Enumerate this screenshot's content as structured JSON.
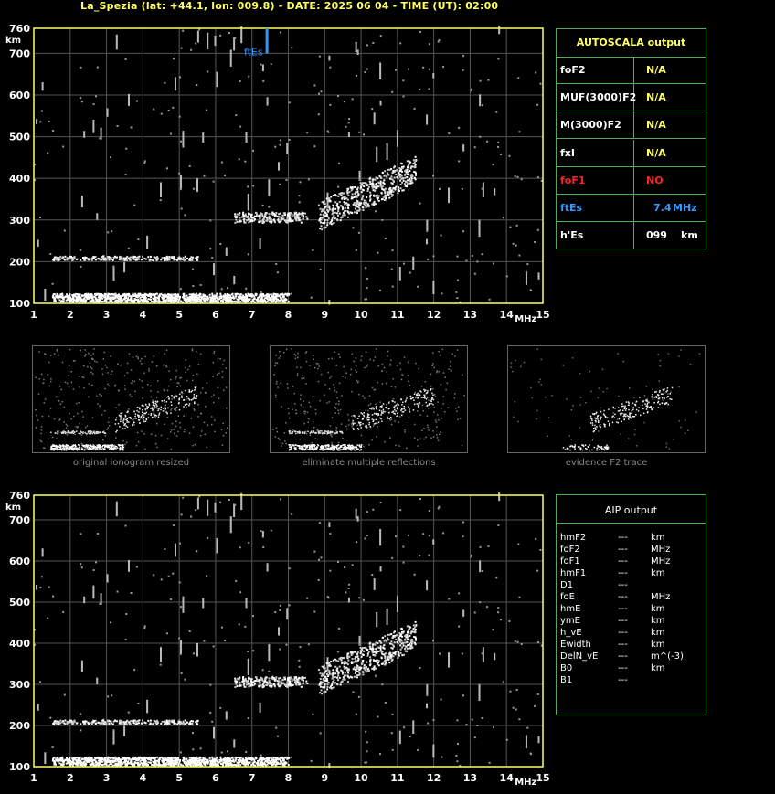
{
  "header": {
    "title": "La_Spezia (lat: +44.1, lon: 009.8) - DATE: 2025 06 04 - TIME (UT): 02:00"
  },
  "colors": {
    "background": "#000000",
    "axis": "#ffff66",
    "grid": "#555555",
    "panel_border": "#4caf50",
    "na_text": "#ffff66",
    "no_text": "#ff2222",
    "fte_text": "#3399ff",
    "trace": "#ffffff"
  },
  "chart_data": [
    {
      "type": "scatter",
      "name": "main-ionogram",
      "xlabel": "MHz",
      "ylabel": "km",
      "xlim": [
        1,
        15
      ],
      "ylim": [
        100,
        760
      ],
      "xticks": [
        1,
        2,
        3,
        4,
        5,
        6,
        7,
        8,
        9,
        10,
        11,
        12,
        13,
        14,
        15
      ],
      "yticks": [
        100,
        200,
        300,
        400,
        500,
        600,
        700,
        760
      ],
      "grid": true,
      "marker_label": "ftEs",
      "marker_x": 7.4,
      "marker_y_range": [
        700,
        760
      ],
      "traces": [
        {
          "name": "Es-layer",
          "x_range": [
            1.5,
            8.0
          ],
          "y_range": [
            105,
            125
          ]
        },
        {
          "name": "multiple-Es",
          "x_range": [
            1.5,
            5.5
          ],
          "y_range": [
            205,
            215
          ]
        },
        {
          "name": "F-trace-low",
          "x_range": [
            6.5,
            8.5
          ],
          "y_range": [
            295,
            320
          ]
        },
        {
          "name": "F-trace-high",
          "x_range": [
            8.8,
            11.5
          ],
          "y_range": [
            310,
            460
          ]
        }
      ]
    },
    {
      "type": "scatter",
      "name": "aip-ionogram",
      "xlabel": "MHz",
      "ylabel": "km",
      "xlim": [
        1,
        15
      ],
      "ylim": [
        100,
        760
      ],
      "xticks": [
        1,
        2,
        3,
        4,
        5,
        6,
        7,
        8,
        9,
        10,
        11,
        12,
        13,
        14,
        15
      ],
      "yticks": [
        100,
        200,
        300,
        400,
        500,
        600,
        700,
        760
      ],
      "grid": true
    }
  ],
  "thumbnails": [
    {
      "caption": "original ionogram resized"
    },
    {
      "caption": "eliminate multiple reflections"
    },
    {
      "caption": "evidence F2 trace"
    }
  ],
  "autoscala": {
    "title": "AUTOSCALA output",
    "rows": [
      {
        "label": "foF2",
        "value": "N/A",
        "unit": ""
      },
      {
        "label": "MUF(3000)F2",
        "value": "N/A",
        "unit": ""
      },
      {
        "label": "M(3000)F2",
        "value": "N/A",
        "unit": ""
      },
      {
        "label": "fxI",
        "value": "N/A",
        "unit": ""
      },
      {
        "label": "foF1",
        "value": "NO",
        "unit": ""
      },
      {
        "label": "ftEs",
        "value": "7.4",
        "unit": "MHz"
      },
      {
        "label": "h'Es",
        "value": "099",
        "unit": "km"
      }
    ]
  },
  "aip": {
    "title": "AIP output",
    "rows": [
      {
        "label": "hmF2",
        "value": "---",
        "unit": "km"
      },
      {
        "label": "foF2",
        "value": "---",
        "unit": "MHz"
      },
      {
        "label": "foF1",
        "value": "---",
        "unit": "MHz"
      },
      {
        "label": "hmF1",
        "value": "---",
        "unit": "km"
      },
      {
        "label": "D1",
        "value": "---",
        "unit": ""
      },
      {
        "label": "foE",
        "value": "---",
        "unit": "MHz"
      },
      {
        "label": "hmE",
        "value": "---",
        "unit": "km"
      },
      {
        "label": "ymE",
        "value": "---",
        "unit": "km"
      },
      {
        "label": "h_vE",
        "value": "---",
        "unit": "km"
      },
      {
        "label": "Ewidth",
        "value": "---",
        "unit": "km"
      },
      {
        "label": "DelN_vE",
        "value": "---",
        "unit": "m^(-3)"
      },
      {
        "label": "B0",
        "value": "---",
        "unit": "km"
      },
      {
        "label": "B1",
        "value": "---",
        "unit": ""
      }
    ]
  }
}
